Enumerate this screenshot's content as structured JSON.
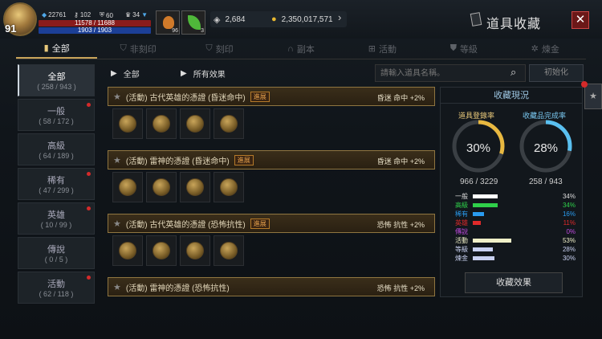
{
  "player": {
    "level": "91",
    "stat_a": "22761",
    "stat_b": "102",
    "stat_c": "60",
    "stat_d": "34",
    "hp": "11578 / 11688",
    "mp": "1903 / 1903",
    "potion_count": "96",
    "herb_count": "3"
  },
  "currency": {
    "diamonds": "2,684",
    "gold": "2,350,017,571"
  },
  "window": {
    "title": "道具收藏",
    "close": "✕"
  },
  "tabs": [
    {
      "label": "全部"
    },
    {
      "label": "非刻印"
    },
    {
      "label": "刻印"
    },
    {
      "label": "副本"
    },
    {
      "label": "活動"
    },
    {
      "label": "等級"
    },
    {
      "label": "煉金"
    }
  ],
  "categories": [
    {
      "name": "全部",
      "count": "( 258 / 943 )",
      "alert": false
    },
    {
      "name": "一般",
      "count": "( 58 / 172 )",
      "alert": true
    },
    {
      "name": "高級",
      "count": "( 64 / 189 )",
      "alert": false
    },
    {
      "name": "稀有",
      "count": "( 47 / 299 )",
      "alert": true
    },
    {
      "name": "英雄",
      "count": "( 10 / 99 )",
      "alert": true
    },
    {
      "name": "傳說",
      "count": "( 0 / 5 )",
      "alert": false
    },
    {
      "name": "活動",
      "count": "( 62 / 118 )",
      "alert": true
    }
  ],
  "filters": {
    "category": "全部",
    "effect": "所有效果",
    "search_placeholder": "請輸入道具名稱。",
    "reset": "初始化"
  },
  "items": [
    {
      "name": "(活動) 古代英雄的憑證 (昏迷命中)",
      "tag": "進展",
      "effect": "昏迷 命中 +2%"
    },
    {
      "name": "(活動) 雷神的憑證 (昏迷命中)",
      "tag": "進展",
      "effect": "昏迷 命中 +2%"
    },
    {
      "name": "(活動) 古代英雄的憑證 (恐怖抗性)",
      "tag": "進展",
      "effect": "恐怖 抗性 +2%"
    },
    {
      "name": "(活動) 雷神的憑證 (恐怖抗性)",
      "tag": "",
      "effect": "恐怖 抗性 +2%"
    }
  ],
  "panel": {
    "title": "收藏現況",
    "reg_label": "道具登錄率",
    "reg_pct": "30%",
    "reg_value": 30,
    "reg_frac": "966 / 3229",
    "comp_label": "收藏品完成率",
    "comp_pct": "28%",
    "comp_value": 28,
    "comp_frac": "258 / 943",
    "effect_button": "收藏效果"
  },
  "breakdown": [
    {
      "name": "一般",
      "pct": "34%",
      "value": 34,
      "color": "#ffffff"
    },
    {
      "name": "高級",
      "pct": "34%",
      "value": 34,
      "color": "#2fd04a"
    },
    {
      "name": "稀有",
      "pct": "16%",
      "value": 16,
      "color": "#2a9cf0"
    },
    {
      "name": "英雄",
      "pct": "11%",
      "value": 11,
      "color": "#e02a2a"
    },
    {
      "name": "傳說",
      "pct": "0%",
      "value": 0,
      "color": "#c04ae0"
    },
    {
      "name": "活動",
      "pct": "53%",
      "value": 53,
      "color": "#f0f0c8"
    },
    {
      "name": "等級",
      "pct": "28%",
      "value": 28,
      "color": "#c8d0f0"
    },
    {
      "name": "煉金",
      "pct": "30%",
      "value": 30,
      "color": "#c8d0f0"
    }
  ]
}
